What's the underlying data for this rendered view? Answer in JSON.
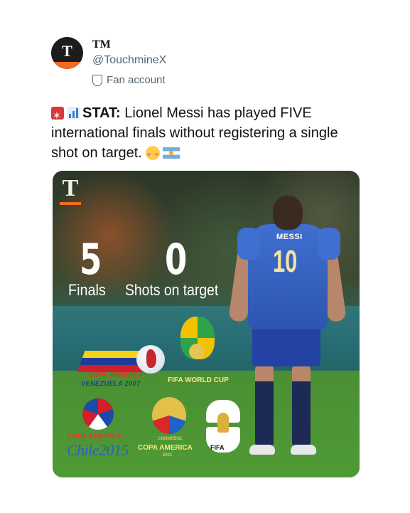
{
  "account": {
    "name": "TM",
    "handle": "@TouchmineX",
    "label": "Fan account",
    "avatar_text": "T",
    "accent_color": "#f26a21"
  },
  "tweet": {
    "stat_label": "STAT:",
    "line1": " Lionel Messi has played FIVE",
    "line2": "international finals without registering a single",
    "line3": "shot on target."
  },
  "media": {
    "logo_text": "T",
    "finals_count": "5",
    "finals_label": "Finals",
    "shots_count": "0",
    "shots_label": "Shots on target",
    "shirt_name": "MESSI",
    "shirt_number": "10",
    "badges": {
      "copa2007_line1": "COPA AMERICA",
      "copa2007_line2": "VENEZUELA 2007",
      "wc2014": "FIFA WORLD CUP",
      "copa2015_line1": "COPA AMERICA",
      "copa2015_line2": "Chile2015",
      "copa2021_small": "CONMEBOL",
      "copa2021_line1": "COPA AMERICA",
      "copa2021_year": "2021",
      "wc2026": "FIFA"
    }
  }
}
